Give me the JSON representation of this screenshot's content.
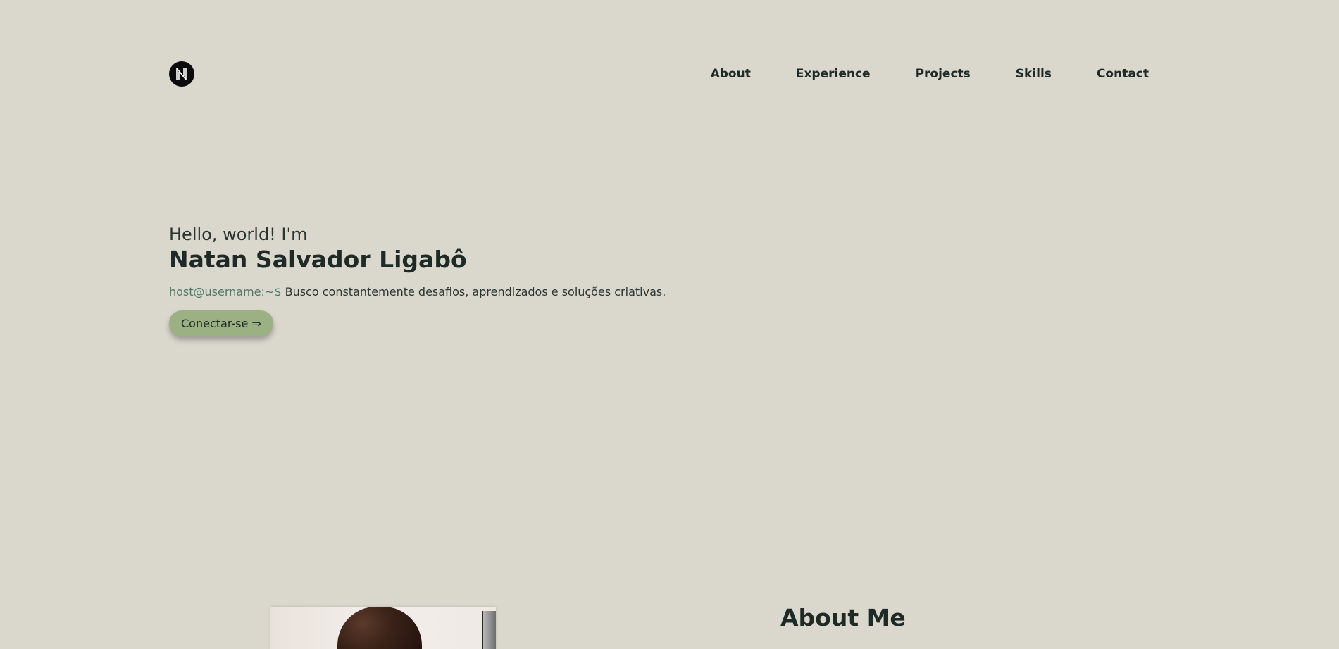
{
  "nav": {
    "items": [
      {
        "label": "About"
      },
      {
        "label": "Experience"
      },
      {
        "label": "Projects"
      },
      {
        "label": "Skills"
      },
      {
        "label": "Contact"
      }
    ]
  },
  "logo": {
    "icon": "n-monogram-logo"
  },
  "hero": {
    "greeting": "Hello, world! I'm",
    "name": "Natan Salvador Ligabô",
    "prompt": "host@username:~$",
    "tagline": "Busco constantemente desafios, aprendizados e soluções criativas.",
    "cta_label": "Conectar-se ⇒"
  },
  "about": {
    "title": "About Me"
  },
  "colors": {
    "background": "#dad8cc",
    "text": "#1f2a26",
    "prompt": "#4e7a63",
    "button": "#9cb183"
  }
}
